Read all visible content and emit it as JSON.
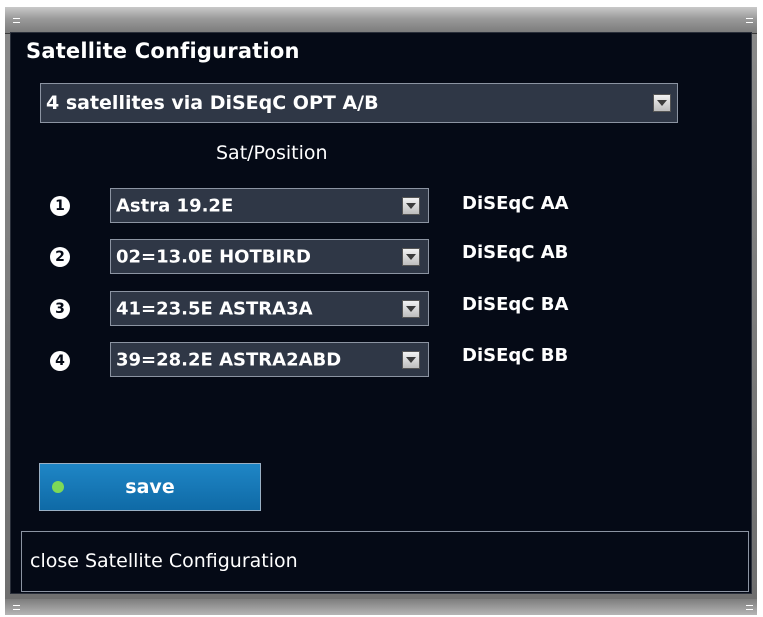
{
  "dialog": {
    "title": "Satellite Configuration"
  },
  "mode": {
    "selected": "4 satellites via DiSEqC OPT A/B"
  },
  "column_header": "Sat/Position",
  "rows": [
    {
      "number": "1",
      "satellite": "Astra 19.2E",
      "diseqc": "DiSEqC AA"
    },
    {
      "number": "2",
      "satellite": "02=13.0E HOTBIRD",
      "diseqc": "DiSEqC AB"
    },
    {
      "number": "3",
      "satellite": "41=23.5E ASTRA3A",
      "diseqc": "DiSEqC BA"
    },
    {
      "number": "4",
      "satellite": "39=28.2E ASTRA2ABD",
      "diseqc": "DiSEqC BB"
    }
  ],
  "save": {
    "label": "save",
    "indicator_color": "#7ed957"
  },
  "status": {
    "text": "close Satellite Configuration"
  },
  "colors": {
    "panel_bg": "#050a16",
    "button_blue": "#1379b8",
    "combo_bg": "#2f3746"
  }
}
